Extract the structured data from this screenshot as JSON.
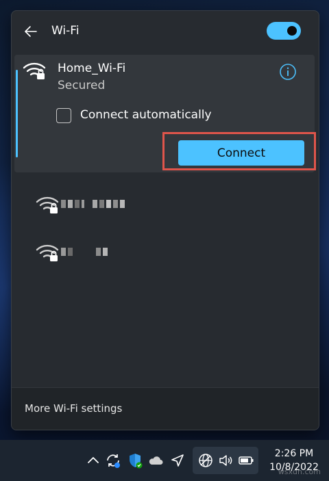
{
  "header": {
    "title": "Wi-Fi",
    "toggle_on": true
  },
  "networks": {
    "selected": {
      "name": "Home_Wi-Fi",
      "status": "Secured",
      "auto_connect_label": "Connect automatically",
      "auto_connect_checked": false,
      "connect_label": "Connect"
    },
    "others": [
      {
        "name_hidden": true,
        "secured": true
      },
      {
        "name_hidden": true,
        "secured": true
      }
    ]
  },
  "footer": {
    "more_settings": "More Wi-Fi settings"
  },
  "taskbar": {
    "clock_time": "2:26 PM",
    "clock_date": "10/8/2022",
    "icons": [
      "chevron-up-icon",
      "sync-icon",
      "defender-shield-icon",
      "onedrive-cloud-icon",
      "location-icon",
      "network-globe-icon",
      "volume-icon",
      "battery-icon"
    ]
  },
  "watermark": "wsxdn.com",
  "colors": {
    "accent": "#4cc2ff",
    "highlight": "#e0554b",
    "flyout_bg": "#272b30",
    "selected_bg": "#33373c"
  }
}
